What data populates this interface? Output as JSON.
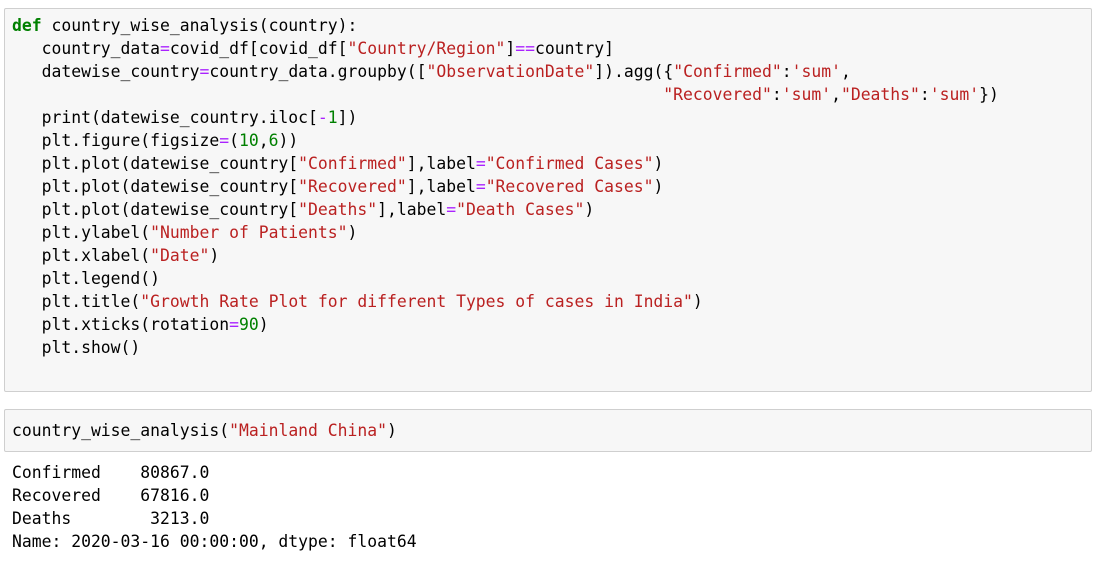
{
  "code_cell": {
    "lines": [
      [
        [
          "kw",
          "def"
        ],
        [
          "plain",
          " country_wise_analysis(country):"
        ]
      ],
      [
        [
          "plain",
          "   country_data"
        ],
        [
          "op",
          "="
        ],
        [
          "plain",
          "covid_df[covid_df["
        ],
        [
          "str",
          "\"Country/Region\""
        ],
        [
          "plain",
          "]"
        ],
        [
          "op",
          "=="
        ],
        [
          "plain",
          "country]"
        ]
      ],
      [
        [
          "plain",
          "   datewise_country"
        ],
        [
          "op",
          "="
        ],
        [
          "plain",
          "country_data.groupby(["
        ],
        [
          "str",
          "\"ObservationDate\""
        ],
        [
          "plain",
          "]).agg({"
        ],
        [
          "str",
          "\"Confirmed\""
        ],
        [
          "plain",
          ":"
        ],
        [
          "str",
          "'sum'"
        ],
        [
          "plain",
          ","
        ]
      ],
      [
        [
          "plain",
          "                                                                  "
        ],
        [
          "str",
          "\"Recovered\""
        ],
        [
          "plain",
          ":"
        ],
        [
          "str",
          "'sum'"
        ],
        [
          "plain",
          ","
        ],
        [
          "str",
          "\"Deaths\""
        ],
        [
          "plain",
          ":"
        ],
        [
          "str",
          "'sum'"
        ],
        [
          "plain",
          "})"
        ]
      ],
      [
        [
          "plain",
          "   print(datewise_country.iloc["
        ],
        [
          "op",
          "-"
        ],
        [
          "num",
          "1"
        ],
        [
          "plain",
          "])"
        ]
      ],
      [
        [
          "plain",
          "   plt.figure(figsize"
        ],
        [
          "op",
          "="
        ],
        [
          "plain",
          "("
        ],
        [
          "num",
          "10"
        ],
        [
          "plain",
          ","
        ],
        [
          "num",
          "6"
        ],
        [
          "plain",
          "))"
        ]
      ],
      [
        [
          "plain",
          "   plt.plot(datewise_country["
        ],
        [
          "str",
          "\"Confirmed\""
        ],
        [
          "plain",
          "],label"
        ],
        [
          "op",
          "="
        ],
        [
          "str",
          "\"Confirmed Cases\""
        ],
        [
          "plain",
          ")"
        ]
      ],
      [
        [
          "plain",
          "   plt.plot(datewise_country["
        ],
        [
          "str",
          "\"Recovered\""
        ],
        [
          "plain",
          "],label"
        ],
        [
          "op",
          "="
        ],
        [
          "str",
          "\"Recovered Cases\""
        ],
        [
          "plain",
          ")"
        ]
      ],
      [
        [
          "plain",
          "   plt.plot(datewise_country["
        ],
        [
          "str",
          "\"Deaths\""
        ],
        [
          "plain",
          "],label"
        ],
        [
          "op",
          "="
        ],
        [
          "str",
          "\"Death Cases\""
        ],
        [
          "plain",
          ")"
        ]
      ],
      [
        [
          "plain",
          "   plt.ylabel("
        ],
        [
          "str",
          "\"Number of Patients\""
        ],
        [
          "plain",
          ")"
        ]
      ],
      [
        [
          "plain",
          "   plt.xlabel("
        ],
        [
          "str",
          "\"Date\""
        ],
        [
          "plain",
          ")"
        ]
      ],
      [
        [
          "plain",
          "   plt.legend()"
        ]
      ],
      [
        [
          "plain",
          "   plt.title("
        ],
        [
          "str",
          "\"Growth Rate Plot for different Types of cases in India\""
        ],
        [
          "plain",
          ")"
        ]
      ],
      [
        [
          "plain",
          "   plt.xticks(rotation"
        ],
        [
          "op",
          "="
        ],
        [
          "num",
          "90"
        ],
        [
          "plain",
          ")"
        ]
      ],
      [
        [
          "plain",
          "   plt.show()"
        ]
      ]
    ]
  },
  "call_cell": {
    "lines": [
      [
        [
          "plain",
          "country_wise_analysis("
        ],
        [
          "str",
          "\"Mainland China\""
        ],
        [
          "plain",
          ")"
        ]
      ]
    ]
  },
  "output": {
    "lines": [
      "Confirmed    80867.0",
      "Recovered    67816.0",
      "Deaths        3213.0",
      "Name: 2020-03-16 00:00:00, dtype: float64"
    ]
  },
  "colors": {
    "keyword": "#008000",
    "string": "#ba2121",
    "operator": "#aa22ff",
    "number": "#008000",
    "cell_background": "#f7f7f7",
    "cell_border": "#cfcfcf"
  }
}
